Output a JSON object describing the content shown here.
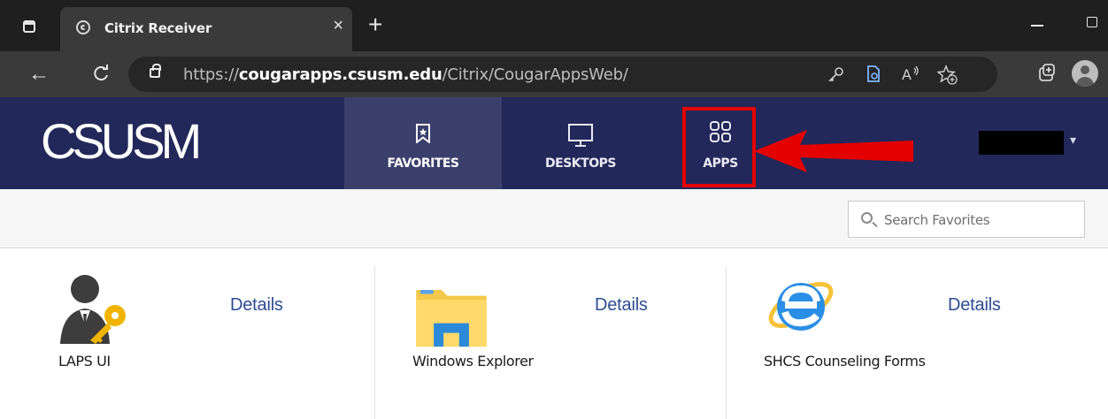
{
  "browser": {
    "tab_title": "Citrix Receiver",
    "tab_close": "×",
    "new_tab": "+",
    "url_scheme": "https://",
    "url_domain": "cougarapps.csusm.edu",
    "url_path": "/Citrix/CougarAppsWeb/",
    "back": "←",
    "reload": "C",
    "icons": [
      "tab-actions-icon",
      "citrix-favicon",
      "lock-icon",
      "key-icon",
      "page-ext-icon",
      "read-aloud-icon",
      "favorite-add-icon",
      "collections-icon",
      "profile-avatar"
    ]
  },
  "header": {
    "logo": "CSUSM",
    "tabs": [
      {
        "label": "FAVORITES",
        "icon": "bookmark-star-icon",
        "active": true
      },
      {
        "label": "DESKTOPS",
        "icon": "monitor-icon",
        "active": false
      },
      {
        "label": "APPS",
        "icon": "apps-grid-icon",
        "active": false
      }
    ],
    "user_menu_caret": "▾",
    "colors": {
      "background": "#23285a",
      "active_tab": "#3b3f6c",
      "highlight": "#e50000"
    }
  },
  "search": {
    "placeholder": "Search Favorites",
    "value": ""
  },
  "apps": [
    {
      "name": "LAPS UI",
      "details": "Details",
      "icon": "user-key-icon"
    },
    {
      "name": "Windows Explorer",
      "details": "Details",
      "icon": "folder-icon"
    },
    {
      "name": "SHCS Counseling Forms",
      "details": "Details",
      "icon": "internet-explorer-icon"
    }
  ]
}
